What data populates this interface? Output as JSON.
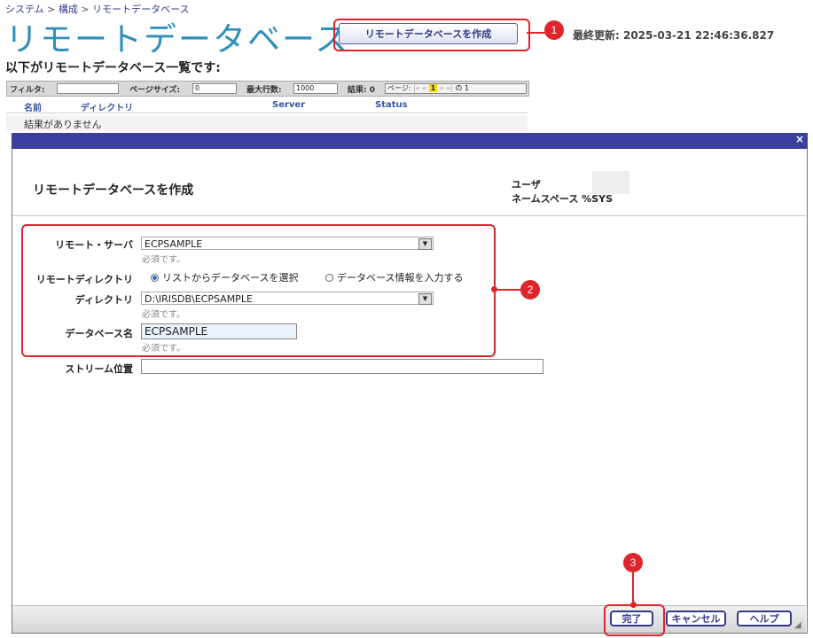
{
  "breadcrumb": {
    "items": [
      "システム",
      "構成",
      "リモートデータベース"
    ],
    "sep": ">"
  },
  "page_title": "リモートデータベース",
  "create_button": "リモートデータベースを作成",
  "last_update": "最終更新: 2025-03-21 22:46:36.827",
  "list_heading": "以下がリモートデータベース一覧です:",
  "table_bar": {
    "filter_label": "フィルタ:",
    "filter_value": "",
    "page_size_label": "ページサイズ:",
    "page_size_value": "0",
    "max_rows_label": "最大行数:",
    "max_rows_value": "1000",
    "results_label": "結果: 0",
    "page_label": "ページ:",
    "pager_first": "|«",
    "pager_prev": "«",
    "current_page": "1",
    "pager_next": "»",
    "pager_last": "»|",
    "of_pages": "の 1"
  },
  "table": {
    "columns": [
      "名前",
      "ディレクトリ",
      "Server",
      "Status"
    ],
    "empty_message": "結果がありません"
  },
  "dialog": {
    "close": "×",
    "title": "リモートデータベースを作成",
    "user_label": "ユーザ",
    "namespace_label": "ネームスペース",
    "namespace_value": "%SYS",
    "remote_server_label": "リモート・サーバ",
    "remote_server_value": "ECPSAMPLE",
    "required_text": "必須です。",
    "remote_dir_label": "リモートディレクトリ",
    "radio_select": "リストからデータベースを選択",
    "radio_input": "データベース情報を入力する",
    "directory_label": "ディレクトリ",
    "directory_value": "D:\\IRISDB\\ECPSAMPLE",
    "db_name_label": "データベース名",
    "db_name_value": "ECPSAMPLE",
    "stream_label": "ストリーム位置",
    "stream_value": "",
    "finish_button": "完了",
    "cancel_button": "キャンセル",
    "help_button": "ヘルプ"
  },
  "callouts": [
    "1",
    "2",
    "3"
  ],
  "colors": {
    "accent": "#e0242c",
    "title_blue": "#2e8fb8",
    "dialog_bar": "#3b3e9e",
    "button_text": "#333a88"
  }
}
